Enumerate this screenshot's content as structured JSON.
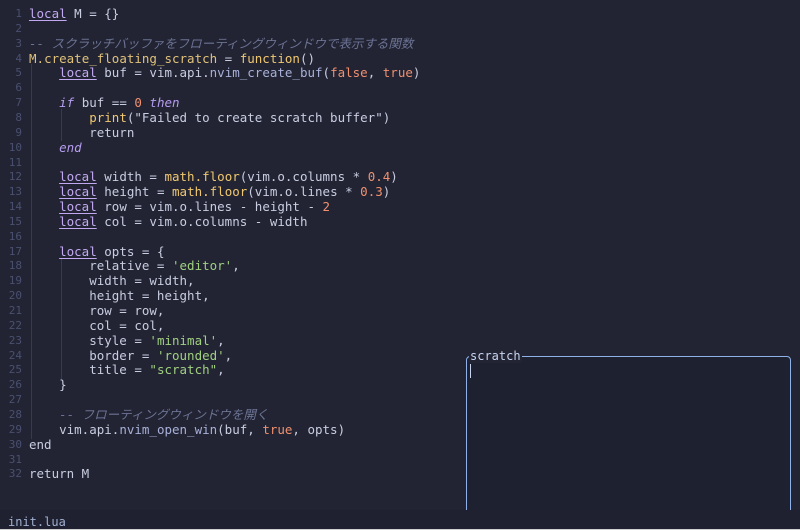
{
  "editor": {
    "lines": [
      {
        "n": "1",
        "segs": [
          [
            "local",
            "kw"
          ],
          [
            " M = {}",
            "id"
          ]
        ]
      },
      {
        "n": "2",
        "segs": []
      },
      {
        "n": "3",
        "segs": [
          [
            "-- スクラッチバッファをフローティングウィンドウで表示する関数",
            "cm"
          ]
        ]
      },
      {
        "n": "4",
        "segs": [
          [
            "M.",
            "fn"
          ],
          [
            "create_floating_scratch",
            "fn"
          ],
          [
            " = ",
            "id"
          ],
          [
            "function",
            "fnb"
          ],
          [
            "()",
            "id"
          ]
        ]
      },
      {
        "n": "5",
        "segs": [
          [
            "    ",
            "id"
          ],
          [
            "local",
            "kw"
          ],
          [
            " buf = vim.api.",
            "id"
          ],
          [
            "nvim_create_buf",
            "field"
          ],
          [
            "(",
            "id"
          ],
          [
            "false",
            "bool"
          ],
          [
            ", ",
            "id"
          ],
          [
            "true",
            "bool"
          ],
          [
            ")",
            "id"
          ]
        ]
      },
      {
        "n": "6",
        "segs": []
      },
      {
        "n": "7",
        "segs": [
          [
            "    ",
            "id"
          ],
          [
            "if",
            "kwi"
          ],
          [
            " buf == ",
            "id"
          ],
          [
            "0",
            "num"
          ],
          [
            " ",
            "id"
          ],
          [
            "then",
            "kwi"
          ]
        ]
      },
      {
        "n": "8",
        "segs": [
          [
            "        ",
            "id"
          ],
          [
            "print",
            "fnb"
          ],
          [
            "(\"Failed to create scratch buffer\")",
            "id"
          ]
        ]
      },
      {
        "n": "9",
        "segs": [
          [
            "        return",
            "id"
          ]
        ]
      },
      {
        "n": "10",
        "segs": [
          [
            "    ",
            "id"
          ],
          [
            "end",
            "kwi"
          ]
        ]
      },
      {
        "n": "11",
        "segs": []
      },
      {
        "n": "12",
        "segs": [
          [
            "    ",
            "id"
          ],
          [
            "local",
            "kw"
          ],
          [
            " width = ",
            "id"
          ],
          [
            "math.floor",
            "fnb"
          ],
          [
            "(vim.o.columns * ",
            "id"
          ],
          [
            "0.4",
            "num"
          ],
          [
            ")",
            "id"
          ]
        ]
      },
      {
        "n": "13",
        "segs": [
          [
            "    ",
            "id"
          ],
          [
            "local",
            "kw"
          ],
          [
            " height = ",
            "id"
          ],
          [
            "math.floor",
            "fnb"
          ],
          [
            "(vim.o.lines * ",
            "id"
          ],
          [
            "0.3",
            "num"
          ],
          [
            ")",
            "id"
          ]
        ]
      },
      {
        "n": "14",
        "segs": [
          [
            "    ",
            "id"
          ],
          [
            "local",
            "kw"
          ],
          [
            " row = vim.o.lines - height - ",
            "id"
          ],
          [
            "2",
            "num"
          ]
        ]
      },
      {
        "n": "15",
        "segs": [
          [
            "    ",
            "id"
          ],
          [
            "local",
            "kw"
          ],
          [
            " col = vim.o.columns - width",
            "id"
          ]
        ]
      },
      {
        "n": "16",
        "segs": []
      },
      {
        "n": "17",
        "segs": [
          [
            "    ",
            "id"
          ],
          [
            "local",
            "kw"
          ],
          [
            " opts = {",
            "id"
          ]
        ]
      },
      {
        "n": "18",
        "segs": [
          [
            "        relative = ",
            "id"
          ],
          [
            "'editor'",
            "str"
          ],
          [
            ",",
            "id"
          ]
        ]
      },
      {
        "n": "19",
        "segs": [
          [
            "        width = width,",
            "id"
          ]
        ]
      },
      {
        "n": "20",
        "segs": [
          [
            "        height = height,",
            "id"
          ]
        ]
      },
      {
        "n": "21",
        "segs": [
          [
            "        row = row,",
            "id"
          ]
        ]
      },
      {
        "n": "22",
        "segs": [
          [
            "        col = col,",
            "id"
          ]
        ]
      },
      {
        "n": "23",
        "segs": [
          [
            "        style = ",
            "id"
          ],
          [
            "'minimal'",
            "str"
          ],
          [
            ",",
            "id"
          ]
        ]
      },
      {
        "n": "24",
        "segs": [
          [
            "        border = ",
            "id"
          ],
          [
            "'rounded'",
            "str"
          ],
          [
            ",",
            "id"
          ]
        ]
      },
      {
        "n": "25",
        "segs": [
          [
            "        title = ",
            "id"
          ],
          [
            "\"scratch\"",
            "str"
          ],
          [
            ",",
            "id"
          ]
        ]
      },
      {
        "n": "26",
        "segs": [
          [
            "    }",
            "id"
          ]
        ]
      },
      {
        "n": "27",
        "segs": []
      },
      {
        "n": "28",
        "segs": [
          [
            "    ",
            "id"
          ],
          [
            "-- フローティングウィンドウを開く",
            "cm"
          ]
        ]
      },
      {
        "n": "29",
        "segs": [
          [
            "    vim.api.",
            "id"
          ],
          [
            "nvim_open_win",
            "field"
          ],
          [
            "(buf, ",
            "id"
          ],
          [
            "true",
            "bool"
          ],
          [
            ", opts)",
            "id"
          ]
        ]
      },
      {
        "n": "30",
        "segs": [
          [
            "end",
            "id"
          ]
        ]
      },
      {
        "n": "31",
        "segs": []
      },
      {
        "n": "32",
        "segs": [
          [
            "return M",
            "id"
          ]
        ]
      }
    ]
  },
  "status": {
    "filename": "init.lua"
  },
  "float_window": {
    "title": "scratch"
  },
  "colors": {
    "background": "#222433",
    "border": "#8fb0e8",
    "keyword": "#c2a8f0",
    "string": "#a0d080",
    "number": "#f09070",
    "comment": "#6c7394",
    "function": "#e0c27a"
  }
}
